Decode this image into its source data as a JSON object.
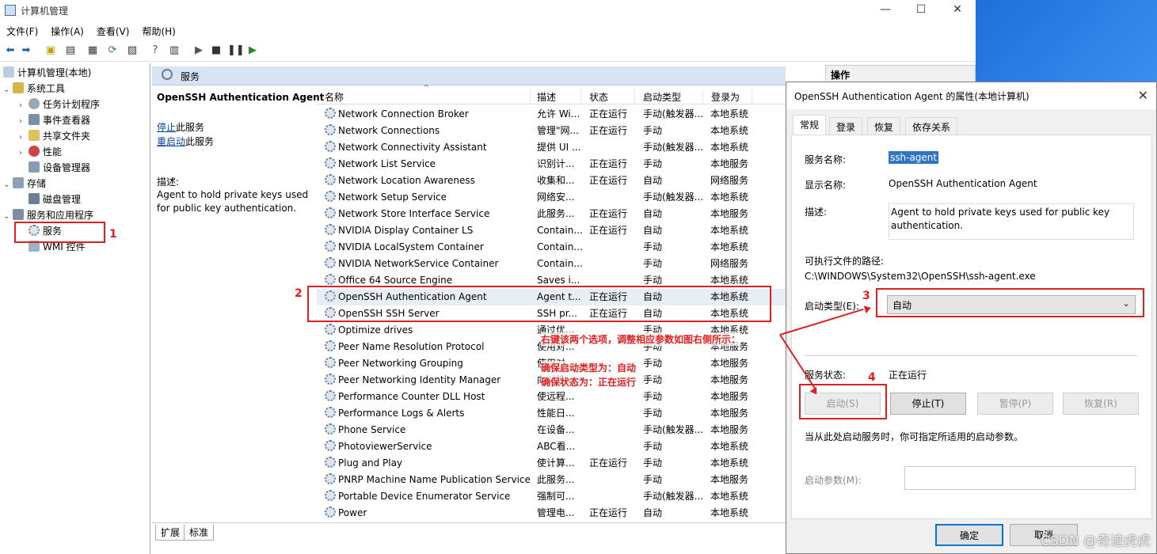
{
  "window": {
    "title": "计算机管理",
    "minimize": "—",
    "maximize": "☐",
    "close": "✕"
  },
  "menu": [
    "文件(F)",
    "操作(A)",
    "查看(V)",
    "帮助(H)"
  ],
  "tree": {
    "root": "计算机管理(本地)",
    "system_tools": "系统工具",
    "task_scheduler": "任务计划程序",
    "event_viewer": "事件查看器",
    "shared_folders": "共享文件夹",
    "performance": "性能",
    "device_manager": "设备管理器",
    "storage": "存储",
    "disk_management": "磁盘管理",
    "services_apps": "服务和应用程序",
    "services": "服务",
    "wmi": "WMI 控件"
  },
  "center": {
    "header": "服务",
    "selected_name": "OpenSSH Authentication Agent",
    "stop_link": "停止",
    "stop_suffix": "此服务",
    "restart_link": "重启动",
    "restart_suffix": "此服务",
    "desc_label": "描述:",
    "desc_text": "Agent to hold private keys used for public key authentication.",
    "columns": [
      "名称",
      "描述",
      "状态",
      "启动类型",
      "登录为"
    ],
    "rows": [
      {
        "name": "Network Connection Broker",
        "desc": "允许 Wi...",
        "status": "正在运行",
        "startup": "手动(触发器...",
        "logon": "本地系统"
      },
      {
        "name": "Network Connections",
        "desc": "管理\"网...",
        "status": "正在运行",
        "startup": "手动",
        "logon": "本地系统"
      },
      {
        "name": "Network Connectivity Assistant",
        "desc": "提供 UI ...",
        "status": "",
        "startup": "手动(触发器...",
        "logon": "本地系统"
      },
      {
        "name": "Network List Service",
        "desc": "识别计...",
        "status": "正在运行",
        "startup": "手动",
        "logon": "本地服务"
      },
      {
        "name": "Network Location Awareness",
        "desc": "收集和...",
        "status": "正在运行",
        "startup": "自动",
        "logon": "网络服务"
      },
      {
        "name": "Network Setup Service",
        "desc": "网络安...",
        "status": "",
        "startup": "手动(触发器...",
        "logon": "本地系统"
      },
      {
        "name": "Network Store Interface Service",
        "desc": "此服务...",
        "status": "正在运行",
        "startup": "自动",
        "logon": "本地服务"
      },
      {
        "name": "NVIDIA Display Container LS",
        "desc": "Contain...",
        "status": "正在运行",
        "startup": "自动",
        "logon": "本地系统"
      },
      {
        "name": "NVIDIA LocalSystem Container",
        "desc": "Contain...",
        "status": "",
        "startup": "手动",
        "logon": "本地系统"
      },
      {
        "name": "NVIDIA NetworkService Container",
        "desc": "Contain...",
        "status": "",
        "startup": "手动",
        "logon": "网络服务"
      },
      {
        "name": "Office 64 Source Engine",
        "desc": "Saves i...",
        "status": "",
        "startup": "手动",
        "logon": "本地系统"
      },
      {
        "name": "OpenSSH Authentication Agent",
        "desc": "Agent t...",
        "status": "正在运行",
        "startup": "自动",
        "logon": "本地系统"
      },
      {
        "name": "OpenSSH SSH Server",
        "desc": "SSH pr...",
        "status": "正在运行",
        "startup": "自动",
        "logon": "本地系统"
      },
      {
        "name": "Optimize drives",
        "desc": "通过优...",
        "status": "",
        "startup": "手动",
        "logon": "本地系统"
      },
      {
        "name": "Peer Name Resolution Protocol",
        "desc": "使用对...",
        "status": "",
        "startup": "手动",
        "logon": "本地服务"
      },
      {
        "name": "Peer Networking Grouping",
        "desc": "使用对...",
        "status": "",
        "startup": "手动",
        "logon": "本地服务"
      },
      {
        "name": "Peer Networking Identity Manager",
        "desc": "向对等...",
        "status": "",
        "startup": "手动",
        "logon": "本地服务"
      },
      {
        "name": "Performance Counter DLL Host",
        "desc": "使远程...",
        "status": "",
        "startup": "手动",
        "logon": "本地服务"
      },
      {
        "name": "Performance Logs & Alerts",
        "desc": "性能日...",
        "status": "",
        "startup": "手动",
        "logon": "本地服务"
      },
      {
        "name": "Phone Service",
        "desc": "在设备...",
        "status": "",
        "startup": "手动(触发器...",
        "logon": "本地服务"
      },
      {
        "name": "PhotoviewerService",
        "desc": "ABC看...",
        "status": "",
        "startup": "手动",
        "logon": "本地系统"
      },
      {
        "name": "Plug and Play",
        "desc": "使计算...",
        "status": "正在运行",
        "startup": "手动",
        "logon": "本地系统"
      },
      {
        "name": "PNRP Machine Name Publication Service",
        "desc": "此服务...",
        "status": "",
        "startup": "手动",
        "logon": "本地服务"
      },
      {
        "name": "Portable Device Enumerator Service",
        "desc": "强制可...",
        "status": "",
        "startup": "手动(触发器...",
        "logon": "本地系统"
      },
      {
        "name": "Power",
        "desc": "管理电...",
        "status": "正在运行",
        "startup": "自动",
        "logon": "本地系统"
      }
    ],
    "tab_extended": "扩展",
    "tab_standard": "标准"
  },
  "actions_header": "操作",
  "dialog": {
    "title": "OpenSSH Authentication Agent 的属性(本地计算机)",
    "close": "✕",
    "tabs": [
      "常规",
      "登录",
      "恢复",
      "依存关系"
    ],
    "service_name_label": "服务名称:",
    "service_name": "ssh-agent",
    "display_name_label": "显示名称:",
    "display_name": "OpenSSH Authentication Agent",
    "desc_label": "描述:",
    "desc_text": "Agent to hold private keys used for public key authentication.",
    "path_label": "可执行文件的路径:",
    "path": "C:\\WINDOWS\\System32\\OpenSSH\\ssh-agent.exe",
    "startup_label": "启动类型(E):",
    "startup_value": "自动",
    "status_label": "服务状态:",
    "status_value": "正在运行",
    "btn_start": "启动(S)",
    "btn_stop": "停止(T)",
    "btn_pause": "暂停(P)",
    "btn_resume": "恢复(R)",
    "hint": "当从此处启动服务时，你可指定所适用的启动参数。",
    "param_label": "启动参数(M):",
    "ok": "确定",
    "cancel": "取消"
  },
  "annotations": {
    "n1": "1",
    "n2": "2",
    "n3": "3",
    "n4": "4",
    "note1": "右键该两个选项，调整相应参数如图右侧所示：",
    "note2": "确保启动类型为：自动",
    "note3": "确保状态为：正在运行"
  },
  "watermark": "CSDN @奇迹虎虎"
}
